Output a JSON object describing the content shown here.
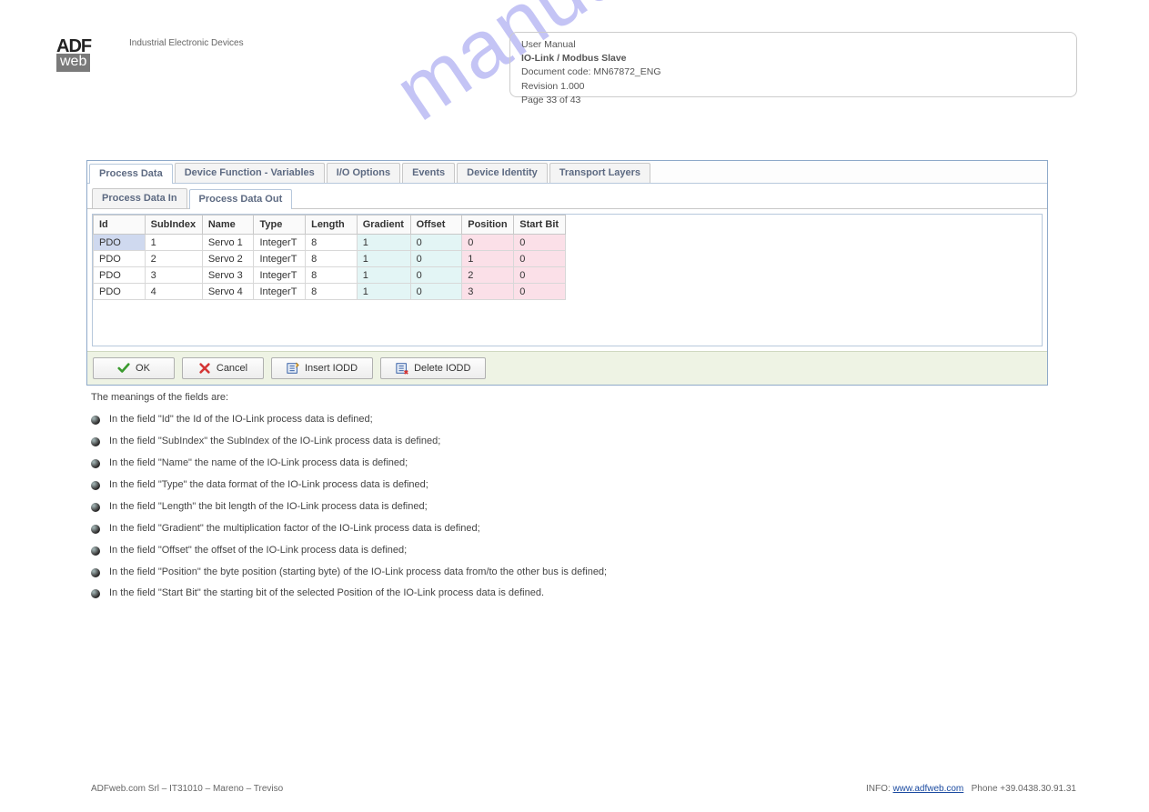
{
  "watermark": "manualshive.com",
  "header": {
    "logo_top": "ADF",
    "logo_bot": "web",
    "left_lines": [
      "Industrial Electronic Devices"
    ],
    "right_box": {
      "l1": "User Manual",
      "l2": "IO-Link / Modbus Slave",
      "l3": "Document code: MN67872_ENG",
      "l4": "Revision 1.000",
      "l5": "Page 33 of 43"
    }
  },
  "section_title": "",
  "panel": {
    "tabs": [
      "Process Data",
      "Device Function - Variables",
      "I/O Options",
      "Events",
      "Device Identity",
      "Transport Layers"
    ],
    "active_tab": 0,
    "subtabs": [
      "Process Data In",
      "Process Data Out"
    ],
    "active_subtab": 1,
    "columns": [
      "Id",
      "SubIndex",
      "Name",
      "Type",
      "Length",
      "Gradient",
      "Offset",
      "Position",
      "Start Bit"
    ],
    "rows": [
      {
        "id": "PDO",
        "sub": "1",
        "name": "Servo 1",
        "type": "IntegerT",
        "len": "8",
        "grad": "1",
        "off": "0",
        "pos": "0",
        "sbit": "0",
        "sel": true
      },
      {
        "id": "PDO",
        "sub": "2",
        "name": "Servo 2",
        "type": "IntegerT",
        "len": "8",
        "grad": "1",
        "off": "0",
        "pos": "1",
        "sbit": "0"
      },
      {
        "id": "PDO",
        "sub": "3",
        "name": "Servo 3",
        "type": "IntegerT",
        "len": "8",
        "grad": "1",
        "off": "0",
        "pos": "2",
        "sbit": "0"
      },
      {
        "id": "PDO",
        "sub": "4",
        "name": "Servo 4",
        "type": "IntegerT",
        "len": "8",
        "grad": "1",
        "off": "0",
        "pos": "3",
        "sbit": "0"
      }
    ],
    "buttons": {
      "ok": "OK",
      "cancel": "Cancel",
      "insert": "Insert IODD",
      "delete": "Delete IODD"
    }
  },
  "description": {
    "intro": "The meanings of the fields are:",
    "items": [
      "In the field \"Id\" the Id of the IO-Link process data is defined;",
      "In the field \"SubIndex\" the SubIndex of the IO-Link process data is defined;",
      "In the field \"Name\" the name of the IO-Link process data is defined;",
      "In the field \"Type\" the data format of the IO-Link process data is defined;",
      "In the field \"Length\" the bit length of the IO-Link process data is defined;",
      "In the field \"Gradient\" the multiplication factor of the IO-Link process data is defined;",
      "In the field \"Offset\" the offset of the IO-Link process data is defined;",
      "In the field \"Position\" the byte position (starting byte) of the IO-Link process data from/to the other bus is defined;",
      "In the field \"Start Bit\" the starting bit of the selected Position of the IO-Link process data is defined."
    ]
  },
  "footer": {
    "left": "ADFweb.com Srl – IT31010 – Mareno – Treviso",
    "right_label": "INFO:",
    "mail": "www.adfweb.com",
    "phone": "Phone +39.0438.30.91.31"
  },
  "pagenum": ""
}
